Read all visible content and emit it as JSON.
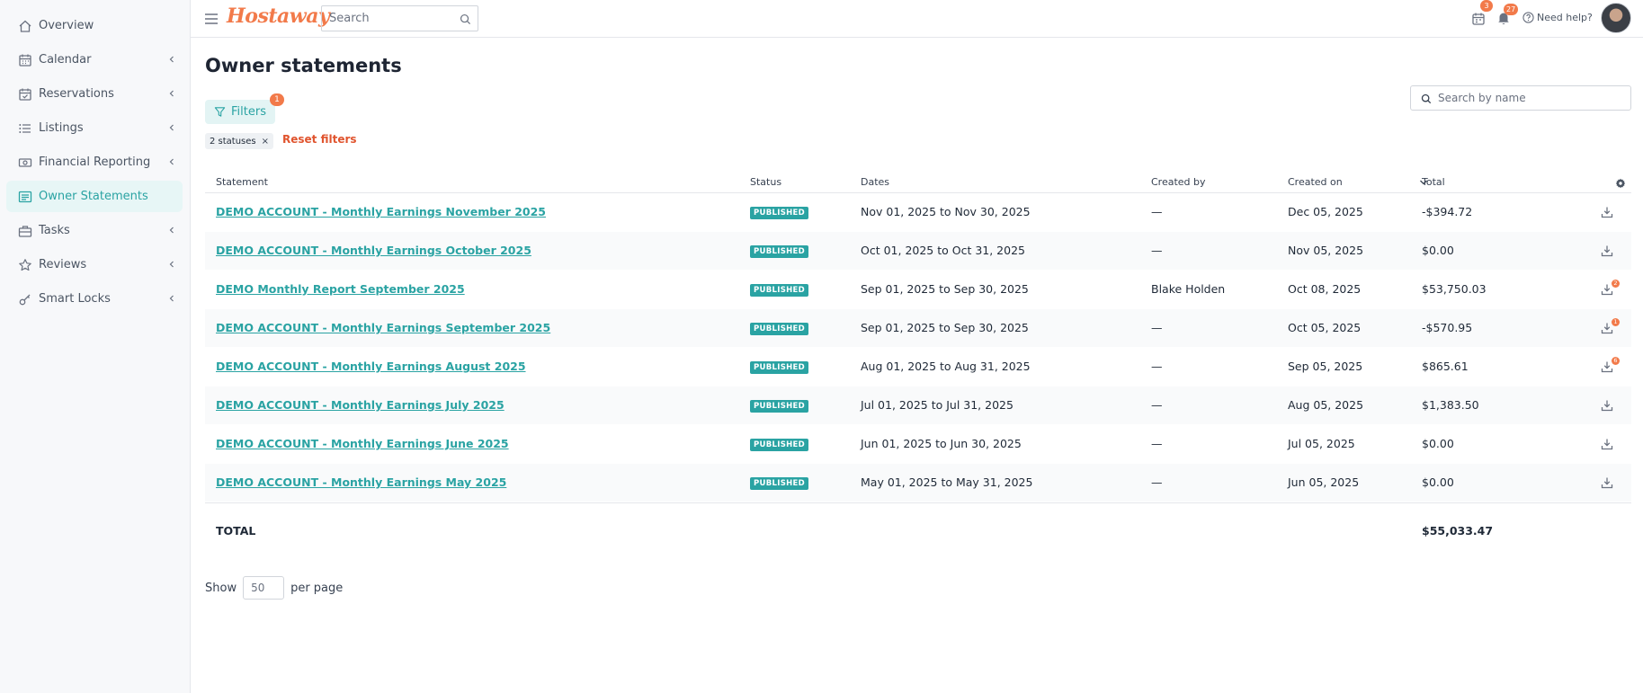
{
  "sidebar": {
    "items": [
      {
        "label": "Overview",
        "icon": "home-icon",
        "has_submenu": false
      },
      {
        "label": "Calendar",
        "icon": "calendar-icon",
        "has_submenu": true
      },
      {
        "label": "Reservations",
        "icon": "reservations-icon",
        "has_submenu": true
      },
      {
        "label": "Listings",
        "icon": "list-icon",
        "has_submenu": true
      },
      {
        "label": "Financial Reporting",
        "icon": "money-icon",
        "has_submenu": true
      },
      {
        "label": "Owner Statements",
        "icon": "statement-icon",
        "has_submenu": false,
        "active": true
      },
      {
        "label": "Tasks",
        "icon": "briefcase-icon",
        "has_submenu": true
      },
      {
        "label": "Reviews",
        "icon": "star-icon",
        "has_submenu": true
      },
      {
        "label": "Smart Locks",
        "icon": "key-icon",
        "has_submenu": true
      }
    ]
  },
  "header": {
    "logo": "Hostaway",
    "search_placeholder": "Search",
    "tasks_badge": "3",
    "notifications_badge": "27",
    "help_label": "Need help?"
  },
  "main": {
    "title": "Owner statements",
    "filters_label": "Filters",
    "filters_badge": "1",
    "chip_label": "2 statuses",
    "chip_close": "×",
    "reset_label": "Reset filters",
    "name_search_placeholder": "Search by name"
  },
  "table": {
    "columns": [
      "Statement",
      "Status",
      "Dates",
      "Created by",
      "Created on",
      "Total"
    ],
    "rows": [
      {
        "statement": "DEMO ACCOUNT - Monthly Earnings November 2025",
        "status": "PUBLISHED",
        "dates": "Nov 01, 2025 to Nov 30, 2025",
        "created_by": "—",
        "created_on": "Dec 05, 2025",
        "total": "-$394.72",
        "badge": ""
      },
      {
        "statement": "DEMO ACCOUNT - Monthly Earnings October 2025",
        "status": "PUBLISHED",
        "dates": "Oct 01, 2025 to Oct 31, 2025",
        "created_by": "—",
        "created_on": "Nov 05, 2025",
        "total": "$0.00",
        "badge": ""
      },
      {
        "statement": "DEMO Monthly Report September 2025",
        "status": "PUBLISHED",
        "dates": "Sep 01, 2025 to Sep 30, 2025",
        "created_by": "Blake Holden",
        "created_on": "Oct 08, 2025",
        "total": "$53,750.03",
        "badge": "2"
      },
      {
        "statement": "DEMO ACCOUNT - Monthly Earnings September 2025",
        "status": "PUBLISHED",
        "dates": "Sep 01, 2025 to Sep 30, 2025",
        "created_by": "—",
        "created_on": "Oct 05, 2025",
        "total": "-$570.95",
        "badge": "1"
      },
      {
        "statement": "DEMO ACCOUNT - Monthly Earnings August 2025",
        "status": "PUBLISHED",
        "dates": "Aug 01, 2025 to Aug 31, 2025",
        "created_by": "—",
        "created_on": "Sep 05, 2025",
        "total": "$865.61",
        "badge": "6"
      },
      {
        "statement": "DEMO ACCOUNT - Monthly Earnings July 2025",
        "status": "PUBLISHED",
        "dates": "Jul 01, 2025 to Jul 31, 2025",
        "created_by": "—",
        "created_on": "Aug 05, 2025",
        "total": "$1,383.50",
        "badge": ""
      },
      {
        "statement": "DEMO ACCOUNT - Monthly Earnings June 2025",
        "status": "PUBLISHED",
        "dates": "Jun 01, 2025 to Jun 30, 2025",
        "created_by": "—",
        "created_on": "Jul 05, 2025",
        "total": "$0.00",
        "badge": ""
      },
      {
        "statement": "DEMO ACCOUNT - Monthly Earnings May 2025",
        "status": "PUBLISHED",
        "dates": "May 01, 2025 to May 31, 2025",
        "created_by": "—",
        "created_on": "Jun 05, 2025",
        "total": "$0.00",
        "badge": ""
      }
    ],
    "total_label": "TOTAL",
    "total_value": "$55,033.47"
  },
  "pagination": {
    "show_label": "Show",
    "per_page_value": "50",
    "per_page_label": "per page"
  },
  "colors": {
    "accent": "#2aa3a3",
    "brand": "#f27a4a",
    "reset": "#e0542e"
  }
}
